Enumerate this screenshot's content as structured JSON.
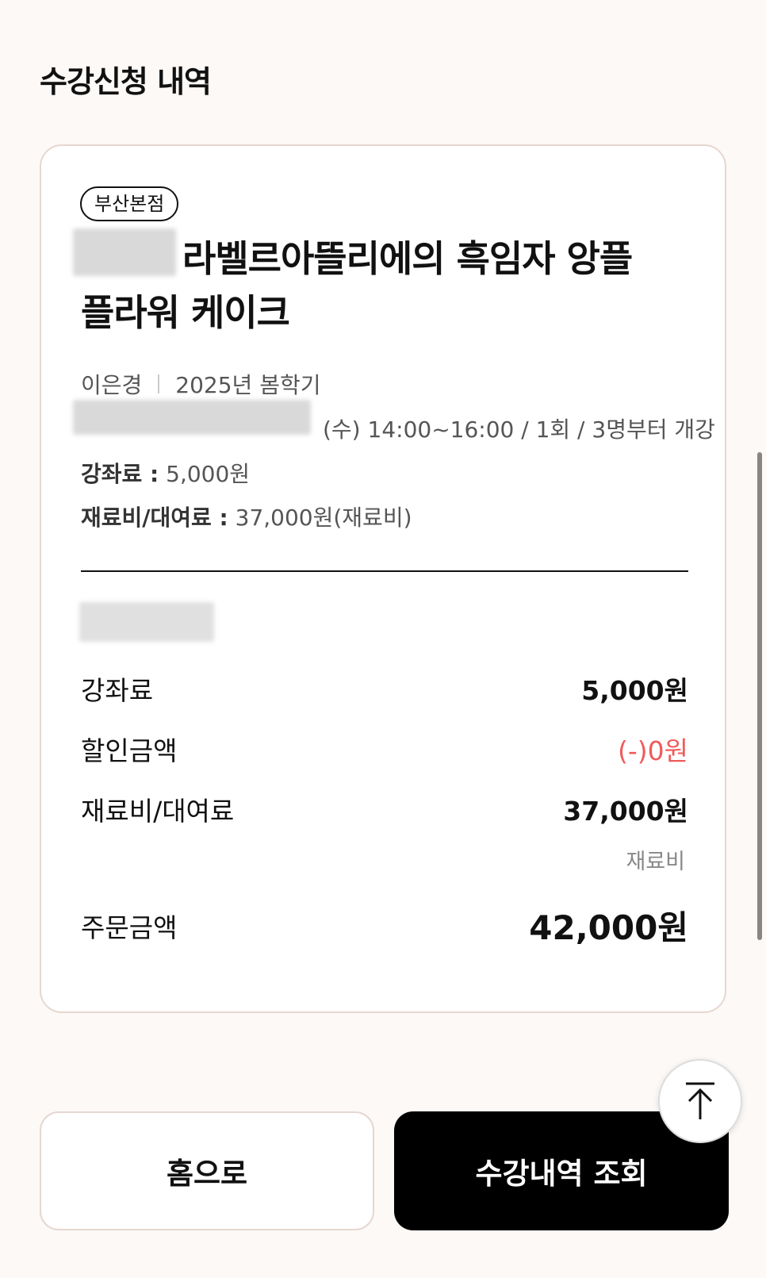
{
  "page": {
    "title": "수강신청 내역"
  },
  "course": {
    "branch": "부산본점",
    "title": "라벨르아뜰리에의 흑임자 앙플 플라워 케이크",
    "instructor": "이은경",
    "term": "2025년 봄학기",
    "schedule": "(수) 14:00~16:00 / 1회 / 3명부터 개강",
    "tuition_label": "강좌료 :",
    "tuition_value": "5,000원",
    "material_label": "재료비/대여료 :",
    "material_value": "37,000원(재료비)"
  },
  "summary": {
    "rows": [
      {
        "label": "강좌료",
        "value": "5,000원"
      },
      {
        "label": "할인금액",
        "value": "(-)0원"
      },
      {
        "label": "재료비/대여료",
        "value": "37,000원"
      }
    ],
    "material_note": "재료비",
    "total_label": "주문금액",
    "total_value": "42,000원"
  },
  "buttons": {
    "home": "홈으로",
    "history": "수강내역 조회"
  },
  "icons": {
    "scroll_top": "arrow-up-to-top-icon"
  },
  "colors": {
    "accent_black": "#000000",
    "discount_red": "#f05a5a",
    "card_border": "#e6d7d0"
  }
}
